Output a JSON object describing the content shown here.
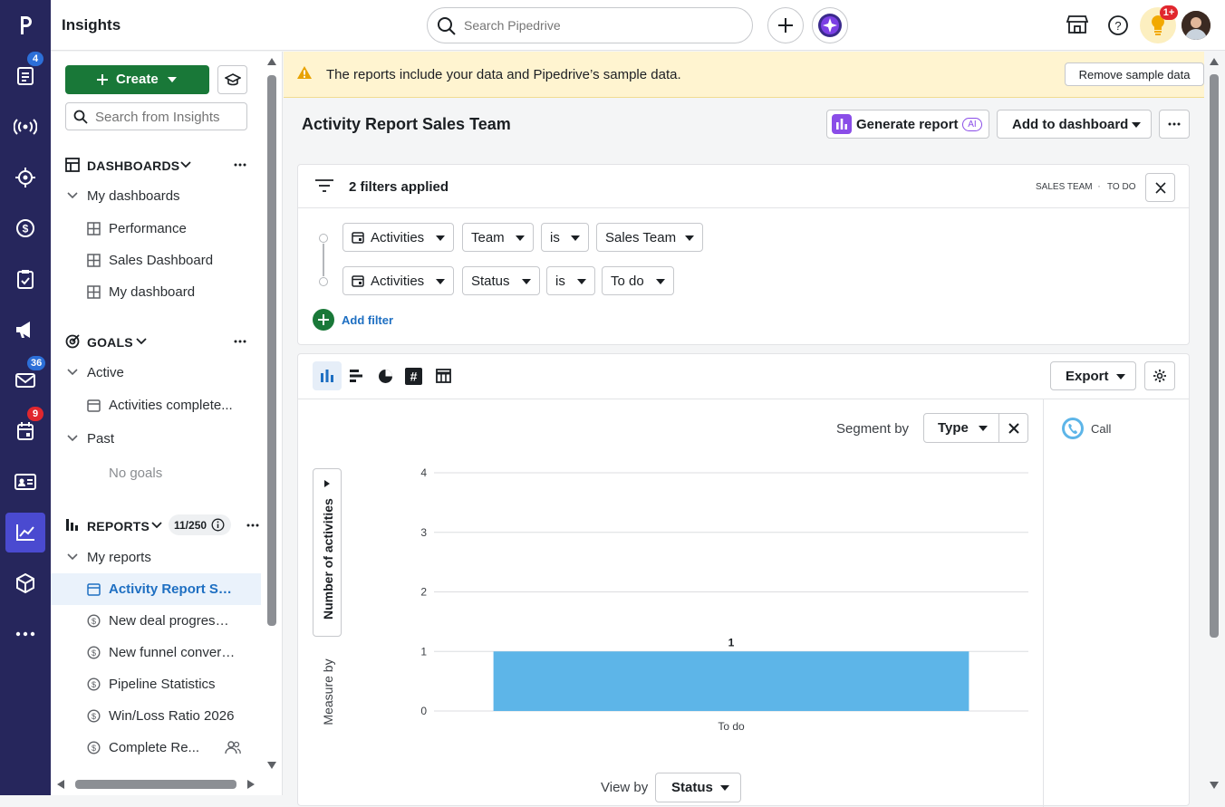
{
  "app": {
    "title": "Insights"
  },
  "rail": {
    "badges": {
      "leads": "4",
      "mail": "36",
      "calendar": "9"
    }
  },
  "topbar": {
    "search_placeholder": "Search Pipedrive",
    "notif_badge": "1+"
  },
  "sidebar": {
    "create_label": "Create",
    "search_placeholder": "Search from Insights",
    "dashboards": {
      "header": "DASHBOARDS",
      "group": "My dashboards",
      "items": [
        "Performance",
        "Sales Dashboard",
        "My dashboard"
      ]
    },
    "goals": {
      "header": "GOALS",
      "active_label": "Active",
      "active_items": [
        "Activities complete..."
      ],
      "past_label": "Past",
      "past_empty": "No goals"
    },
    "reports": {
      "header": "REPORTS",
      "count": "11/250",
      "group": "My reports",
      "items": [
        "Activity Report Sal...",
        "New deal progress r...",
        "New funnel convers...",
        "Pipeline Statistics",
        "Win/Loss Ratio 2026",
        "Complete Re..."
      ]
    }
  },
  "banner": {
    "text": "The reports include your data and Pipedrive’s sample data.",
    "button": "Remove sample data"
  },
  "report": {
    "title": "Activity Report Sales Team",
    "generate_label": "Generate report",
    "ai_badge": "AI",
    "add_to_dashboard": "Add to dashboard"
  },
  "filters": {
    "summary": "2 filters applied",
    "tags": [
      "SALES TEAM",
      "TO DO"
    ],
    "rows": [
      {
        "entity": "Activities",
        "field": "Team",
        "op": "is",
        "value": "Sales Team"
      },
      {
        "entity": "Activities",
        "field": "Status",
        "op": "is",
        "value": "To do"
      }
    ],
    "add_label": "Add filter"
  },
  "chart_panel": {
    "export_label": "Export",
    "segment_label": "Segment by",
    "segment_value": "Type",
    "measure_label": "Measure by",
    "measure_value": "Number of activities",
    "view_label": "View by",
    "view_value": "Status",
    "legend": [
      {
        "name": "Call",
        "color": "#5db5e8"
      }
    ]
  },
  "chart_data": {
    "type": "bar",
    "categories": [
      "To do"
    ],
    "series": [
      {
        "name": "Call",
        "values": [
          1
        ]
      }
    ],
    "data_labels": [
      "1"
    ],
    "xlabel": "",
    "ylabel": "Number of activities",
    "ylim": [
      0,
      4
    ],
    "yticks": [
      "0",
      "1",
      "2",
      "3",
      "4"
    ],
    "grid": true,
    "bar_color": "#5db5e8"
  }
}
